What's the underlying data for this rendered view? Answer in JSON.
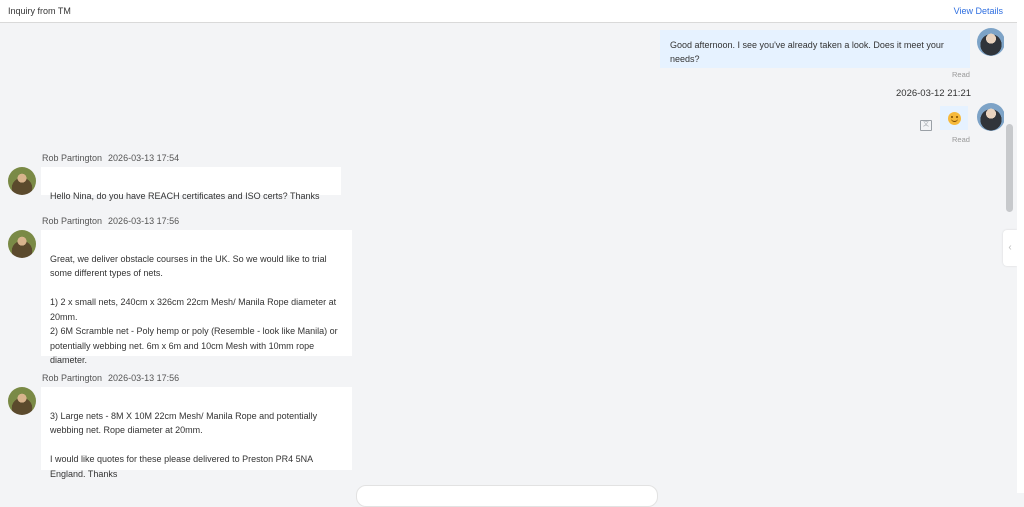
{
  "header": {
    "title": "Inquiry from TM",
    "view_details": "View Details"
  },
  "messages": {
    "m1": {
      "text": "Good afternoon. I see you've already taken a look. Does it meet your needs?",
      "status": "Read"
    },
    "timestamp": "2026-03-12 21:21",
    "m2": {
      "status": "Read"
    },
    "m3": {
      "sender": "Rob Partington",
      "time": "2026-03-13 17:54",
      "text": "Hello Nina, do you have REACH certificates and ISO certs? Thanks"
    },
    "m4": {
      "sender": "Rob Partington",
      "time": "2026-03-13 17:56",
      "text": "Great, we deliver obstacle courses in the UK. So we would like to trial some different types of nets.\n\n1) 2 x small nets, 240cm x 326cm 22cm Mesh/ Manila Rope diameter at 20mm.\n2) 6M Scramble net - Poly hemp or poly (Resemble - look like Manila) or potentially webbing net. 6m x 6m and 10cm Mesh with 10mm rope diameter."
    },
    "m5": {
      "sender": "Rob Partington",
      "time": "2026-03-13 17:56",
      "text": "3) Large nets - 8M X 10M 22cm Mesh/ Manila Rope and potentially webbing net. Rope diameter at 20mm.\n\nI would like quotes for these please delivered to Preston PR4 5NA England. Thanks"
    }
  },
  "side_tab": {
    "glyph": "‹"
  }
}
